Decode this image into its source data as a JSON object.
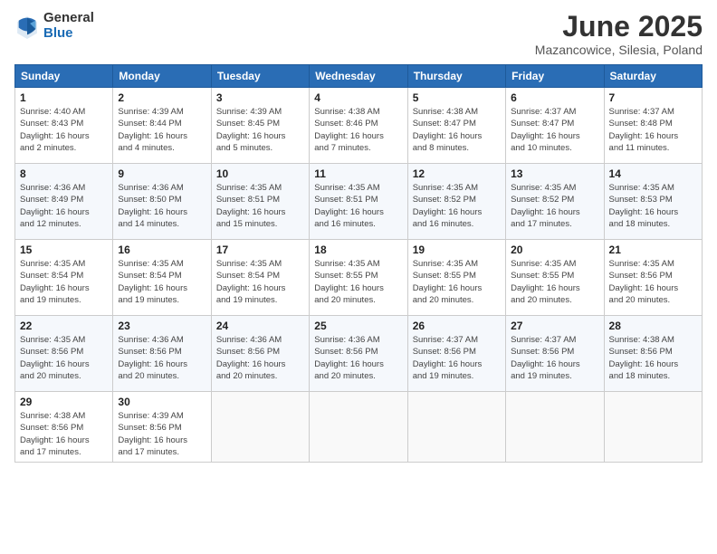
{
  "header": {
    "logo_general": "General",
    "logo_blue": "Blue",
    "title": "June 2025",
    "location": "Mazancowice, Silesia, Poland"
  },
  "days_of_week": [
    "Sunday",
    "Monday",
    "Tuesday",
    "Wednesday",
    "Thursday",
    "Friday",
    "Saturday"
  ],
  "weeks": [
    [
      {
        "day": "1",
        "info": "Sunrise: 4:40 AM\nSunset: 8:43 PM\nDaylight: 16 hours\nand 2 minutes."
      },
      {
        "day": "2",
        "info": "Sunrise: 4:39 AM\nSunset: 8:44 PM\nDaylight: 16 hours\nand 4 minutes."
      },
      {
        "day": "3",
        "info": "Sunrise: 4:39 AM\nSunset: 8:45 PM\nDaylight: 16 hours\nand 5 minutes."
      },
      {
        "day": "4",
        "info": "Sunrise: 4:38 AM\nSunset: 8:46 PM\nDaylight: 16 hours\nand 7 minutes."
      },
      {
        "day": "5",
        "info": "Sunrise: 4:38 AM\nSunset: 8:47 PM\nDaylight: 16 hours\nand 8 minutes."
      },
      {
        "day": "6",
        "info": "Sunrise: 4:37 AM\nSunset: 8:47 PM\nDaylight: 16 hours\nand 10 minutes."
      },
      {
        "day": "7",
        "info": "Sunrise: 4:37 AM\nSunset: 8:48 PM\nDaylight: 16 hours\nand 11 minutes."
      }
    ],
    [
      {
        "day": "8",
        "info": "Sunrise: 4:36 AM\nSunset: 8:49 PM\nDaylight: 16 hours\nand 12 minutes."
      },
      {
        "day": "9",
        "info": "Sunrise: 4:36 AM\nSunset: 8:50 PM\nDaylight: 16 hours\nand 14 minutes."
      },
      {
        "day": "10",
        "info": "Sunrise: 4:35 AM\nSunset: 8:51 PM\nDaylight: 16 hours\nand 15 minutes."
      },
      {
        "day": "11",
        "info": "Sunrise: 4:35 AM\nSunset: 8:51 PM\nDaylight: 16 hours\nand 16 minutes."
      },
      {
        "day": "12",
        "info": "Sunrise: 4:35 AM\nSunset: 8:52 PM\nDaylight: 16 hours\nand 16 minutes."
      },
      {
        "day": "13",
        "info": "Sunrise: 4:35 AM\nSunset: 8:52 PM\nDaylight: 16 hours\nand 17 minutes."
      },
      {
        "day": "14",
        "info": "Sunrise: 4:35 AM\nSunset: 8:53 PM\nDaylight: 16 hours\nand 18 minutes."
      }
    ],
    [
      {
        "day": "15",
        "info": "Sunrise: 4:35 AM\nSunset: 8:54 PM\nDaylight: 16 hours\nand 19 minutes."
      },
      {
        "day": "16",
        "info": "Sunrise: 4:35 AM\nSunset: 8:54 PM\nDaylight: 16 hours\nand 19 minutes."
      },
      {
        "day": "17",
        "info": "Sunrise: 4:35 AM\nSunset: 8:54 PM\nDaylight: 16 hours\nand 19 minutes."
      },
      {
        "day": "18",
        "info": "Sunrise: 4:35 AM\nSunset: 8:55 PM\nDaylight: 16 hours\nand 20 minutes."
      },
      {
        "day": "19",
        "info": "Sunrise: 4:35 AM\nSunset: 8:55 PM\nDaylight: 16 hours\nand 20 minutes."
      },
      {
        "day": "20",
        "info": "Sunrise: 4:35 AM\nSunset: 8:55 PM\nDaylight: 16 hours\nand 20 minutes."
      },
      {
        "day": "21",
        "info": "Sunrise: 4:35 AM\nSunset: 8:56 PM\nDaylight: 16 hours\nand 20 minutes."
      }
    ],
    [
      {
        "day": "22",
        "info": "Sunrise: 4:35 AM\nSunset: 8:56 PM\nDaylight: 16 hours\nand 20 minutes."
      },
      {
        "day": "23",
        "info": "Sunrise: 4:36 AM\nSunset: 8:56 PM\nDaylight: 16 hours\nand 20 minutes."
      },
      {
        "day": "24",
        "info": "Sunrise: 4:36 AM\nSunset: 8:56 PM\nDaylight: 16 hours\nand 20 minutes."
      },
      {
        "day": "25",
        "info": "Sunrise: 4:36 AM\nSunset: 8:56 PM\nDaylight: 16 hours\nand 20 minutes."
      },
      {
        "day": "26",
        "info": "Sunrise: 4:37 AM\nSunset: 8:56 PM\nDaylight: 16 hours\nand 19 minutes."
      },
      {
        "day": "27",
        "info": "Sunrise: 4:37 AM\nSunset: 8:56 PM\nDaylight: 16 hours\nand 19 minutes."
      },
      {
        "day": "28",
        "info": "Sunrise: 4:38 AM\nSunset: 8:56 PM\nDaylight: 16 hours\nand 18 minutes."
      }
    ],
    [
      {
        "day": "29",
        "info": "Sunrise: 4:38 AM\nSunset: 8:56 PM\nDaylight: 16 hours\nand 17 minutes."
      },
      {
        "day": "30",
        "info": "Sunrise: 4:39 AM\nSunset: 8:56 PM\nDaylight: 16 hours\nand 17 minutes."
      },
      {
        "day": "",
        "info": ""
      },
      {
        "day": "",
        "info": ""
      },
      {
        "day": "",
        "info": ""
      },
      {
        "day": "",
        "info": ""
      },
      {
        "day": "",
        "info": ""
      }
    ]
  ]
}
